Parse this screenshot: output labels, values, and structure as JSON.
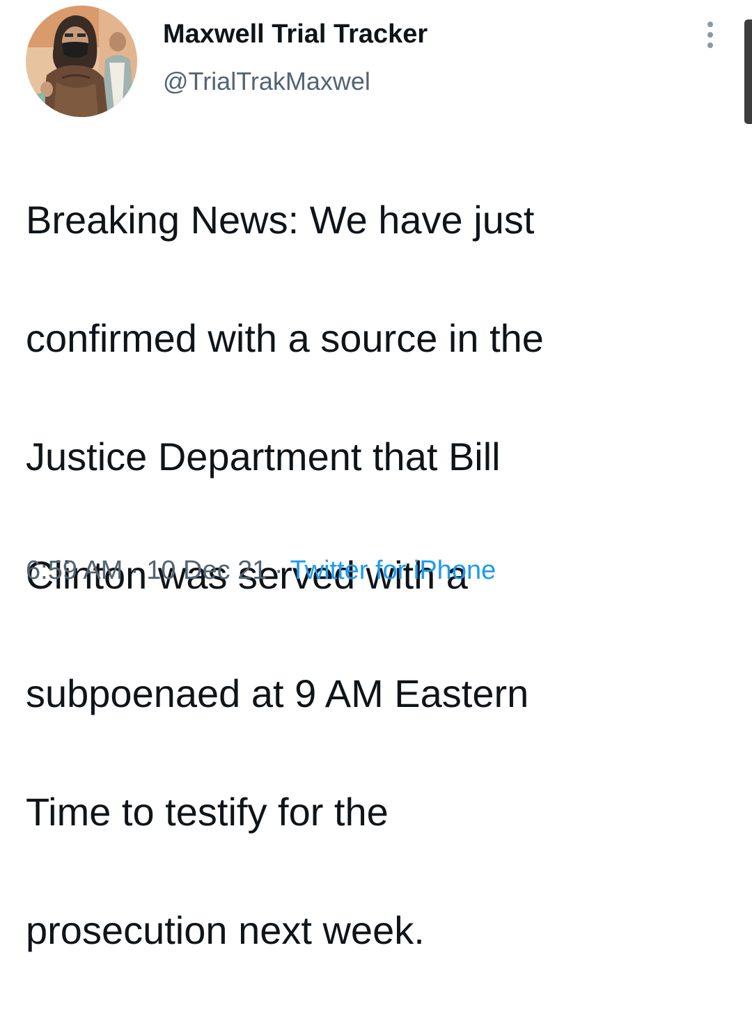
{
  "tweet": {
    "display_name": "Maxwell Trial Tracker",
    "handle": "@TrialTrakMaxwel",
    "avatar_icon": "courtroom-sketch-avatar",
    "more_icon": "more-vertical-icon",
    "text_lines": [
      "Breaking News: We have just",
      "confirmed with a source in the",
      "Justice Department that Bill",
      "Clinton was served with a",
      "subpoenaed at 9 AM Eastern",
      "Time to testify for the",
      "prosecution next week."
    ],
    "time": "6:59 AM",
    "separator": "·",
    "date": "10 Dec 21",
    "source": "Twitter for iPhone"
  },
  "colors": {
    "text_primary": "#0f1419",
    "text_secondary": "#536471",
    "link": "#1d9bf0"
  }
}
